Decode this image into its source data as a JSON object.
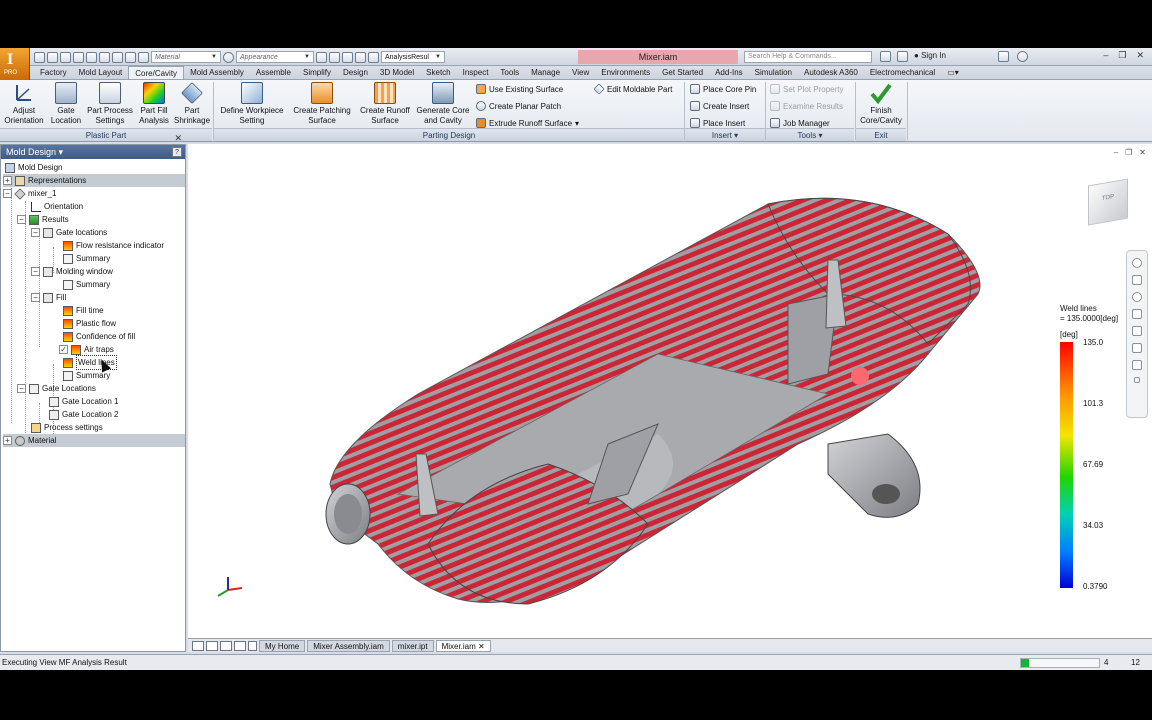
{
  "window": {
    "title": "Mixer.iam",
    "search_placeholder": "Search Help & Commands...",
    "sign_in": "Sign In",
    "app_badge": "PRO",
    "material_placeholder": "Material",
    "appearance_placeholder": "Appearance",
    "analysis_dropdown": "AnalysisResul"
  },
  "tabs": [
    {
      "label": "Factory"
    },
    {
      "label": "Mold Layout"
    },
    {
      "label": "Core/Cavity",
      "active": true
    },
    {
      "label": "Mold Assembly"
    },
    {
      "label": "Assemble"
    },
    {
      "label": "Simplify"
    },
    {
      "label": "Design"
    },
    {
      "label": "3D Model"
    },
    {
      "label": "Sketch"
    },
    {
      "label": "Inspect"
    },
    {
      "label": "Tools"
    },
    {
      "label": "Manage"
    },
    {
      "label": "View"
    },
    {
      "label": "Environments"
    },
    {
      "label": "Get Started"
    },
    {
      "label": "Add-Ins"
    },
    {
      "label": "Simulation"
    },
    {
      "label": "Autodesk A360"
    },
    {
      "label": "Electromechanical"
    }
  ],
  "ribbon": {
    "plastic_part": {
      "label": "Plastic Part",
      "buttons": {
        "adjust_orientation": "Adjust Orientation",
        "gate_location": "Gate Location",
        "part_process_settings": "Part Process Settings",
        "part_fill_analysis": "Part Fill Analysis",
        "part_shrinkage": "Part Shrinkage"
      }
    },
    "parting_design": {
      "label": "Parting Design",
      "buttons": {
        "define_workpiece": "Define Workpiece Setting",
        "create_patching": "Create Patching Surface",
        "create_runoff": "Create Runoff Surface",
        "generate_core": "Generate Core and Cavity",
        "use_existing": "Use Existing Surface",
        "create_planar": "Create Planar Patch",
        "extrude_runoff": "Extrude Runoff Surface",
        "edit_moldable": "Edit Moldable Part"
      }
    },
    "insert": {
      "label": "Insert",
      "buttons": {
        "place_core_pin": "Place Core Pin",
        "create_insert": "Create Insert",
        "place_insert": "Place Insert"
      }
    },
    "tools": {
      "label": "Tools",
      "buttons": {
        "set_plot_property": "Set Plot Property",
        "examine_results": "Examine Results",
        "job_manager": "Job Manager"
      }
    },
    "exit": {
      "label": "Exit",
      "buttons": {
        "finish": "Finish Core/Cavity"
      }
    }
  },
  "browser": {
    "title": "Mold Design",
    "nodes": {
      "mold_design": "Mold Design",
      "representations": "Representations",
      "mixer": "mixer_1",
      "orientation": "Orientation",
      "results": "Results",
      "gate_locations": "Gate locations",
      "flow_resistance": "Flow resistance indicator",
      "summary_1": "Summary",
      "molding_window": "Molding window",
      "summary_2": "Summary",
      "fill": "Fill",
      "fill_time": "Fill time",
      "plastic_flow": "Plastic flow",
      "confidence": "Confidence of fill",
      "air_traps": "Air traps",
      "weld_lines": "Weld lines",
      "summary_3": "Summary",
      "gate_locations_2": "Gate Locations",
      "gate_loc_1": "Gate Location 1",
      "gate_loc_2": "Gate Location 2",
      "process_settings": "Process settings",
      "material": "Material"
    }
  },
  "legend": {
    "title": "Weld lines",
    "value": "= 135.0000[deg]",
    "unit": "[deg]",
    "ticks": [
      "135.0",
      "101.3",
      "67.69",
      "34.03",
      "0.3790"
    ],
    "colors": [
      "#ff0000",
      "#ff8c00",
      "#f2e600",
      "#22d400",
      "#00d2b4",
      "#0080ff",
      "#0000d8"
    ]
  },
  "viewcube": {
    "face": "TOP"
  },
  "doc_tabs": [
    {
      "label": "My Home"
    },
    {
      "label": "Mixer Assembly.iam"
    },
    {
      "label": "mixer.ipt"
    },
    {
      "label": "Mixer.iam",
      "active": true
    }
  ],
  "status": {
    "text": "Executing View MF Analysis Result",
    "progress": 0.1,
    "count_1": "4",
    "count_2": "12"
  }
}
